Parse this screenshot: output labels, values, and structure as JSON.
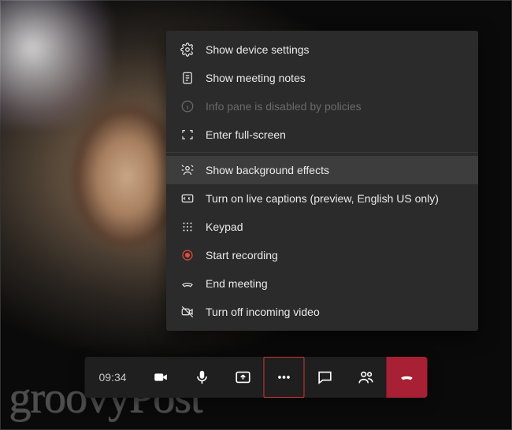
{
  "menu": {
    "items": [
      {
        "label": "Show device settings"
      },
      {
        "label": "Show meeting notes"
      },
      {
        "label": "Info pane is disabled by policies"
      },
      {
        "label": "Enter full-screen"
      },
      {
        "label": "Show background effects"
      },
      {
        "label": "Turn on live captions (preview, English US only)"
      },
      {
        "label": "Keypad"
      },
      {
        "label": "Start recording"
      },
      {
        "label": "End meeting"
      },
      {
        "label": "Turn off incoming video"
      }
    ]
  },
  "toolbar": {
    "time": "09:34"
  },
  "watermark": "groovyPost"
}
